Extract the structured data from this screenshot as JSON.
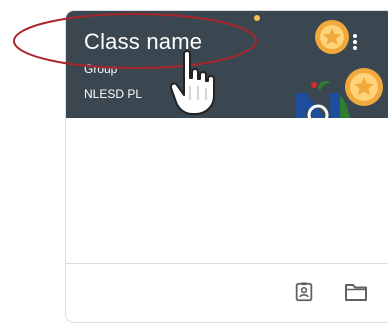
{
  "class_card": {
    "name": "Class name",
    "section": "Group",
    "owner": "NLESD PL"
  },
  "icons": {
    "more": "more-vert-icon",
    "assignments": "assignment-ind-icon",
    "folder": "folder-icon",
    "pointer": "hand-pointer-icon",
    "coin": "coin-icon",
    "logo": "nlesd-logo"
  },
  "colors": {
    "header": "#3a4750",
    "highlight_ring": "#a8252b",
    "coin": "#f2a93b",
    "logo_blue": "#1f4e9c",
    "logo_green": "#2e7d32"
  }
}
